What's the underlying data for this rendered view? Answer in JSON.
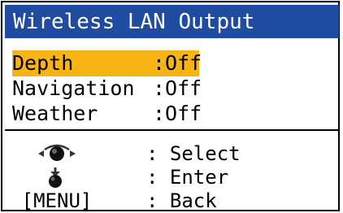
{
  "window": {
    "title": "Wireless LAN Output"
  },
  "menu": {
    "items": [
      {
        "label": "Depth",
        "value": ":Off",
        "selected": true
      },
      {
        "label": "Navigation",
        "value": ":Off",
        "selected": false
      },
      {
        "label": "Weather",
        "value": ":Off",
        "selected": false
      }
    ]
  },
  "help": {
    "rows": [
      {
        "key_icon": "rotate-knob-icon",
        "action": ": Select"
      },
      {
        "key_icon": "push-knob-icon",
        "action": ": Enter"
      },
      {
        "key": "[MENU]",
        "action": ": Back"
      }
    ]
  },
  "colors": {
    "titlebar": "#1f4ca0",
    "highlight": "#f7b413",
    "text": "#000000",
    "background": "#ffffff"
  }
}
